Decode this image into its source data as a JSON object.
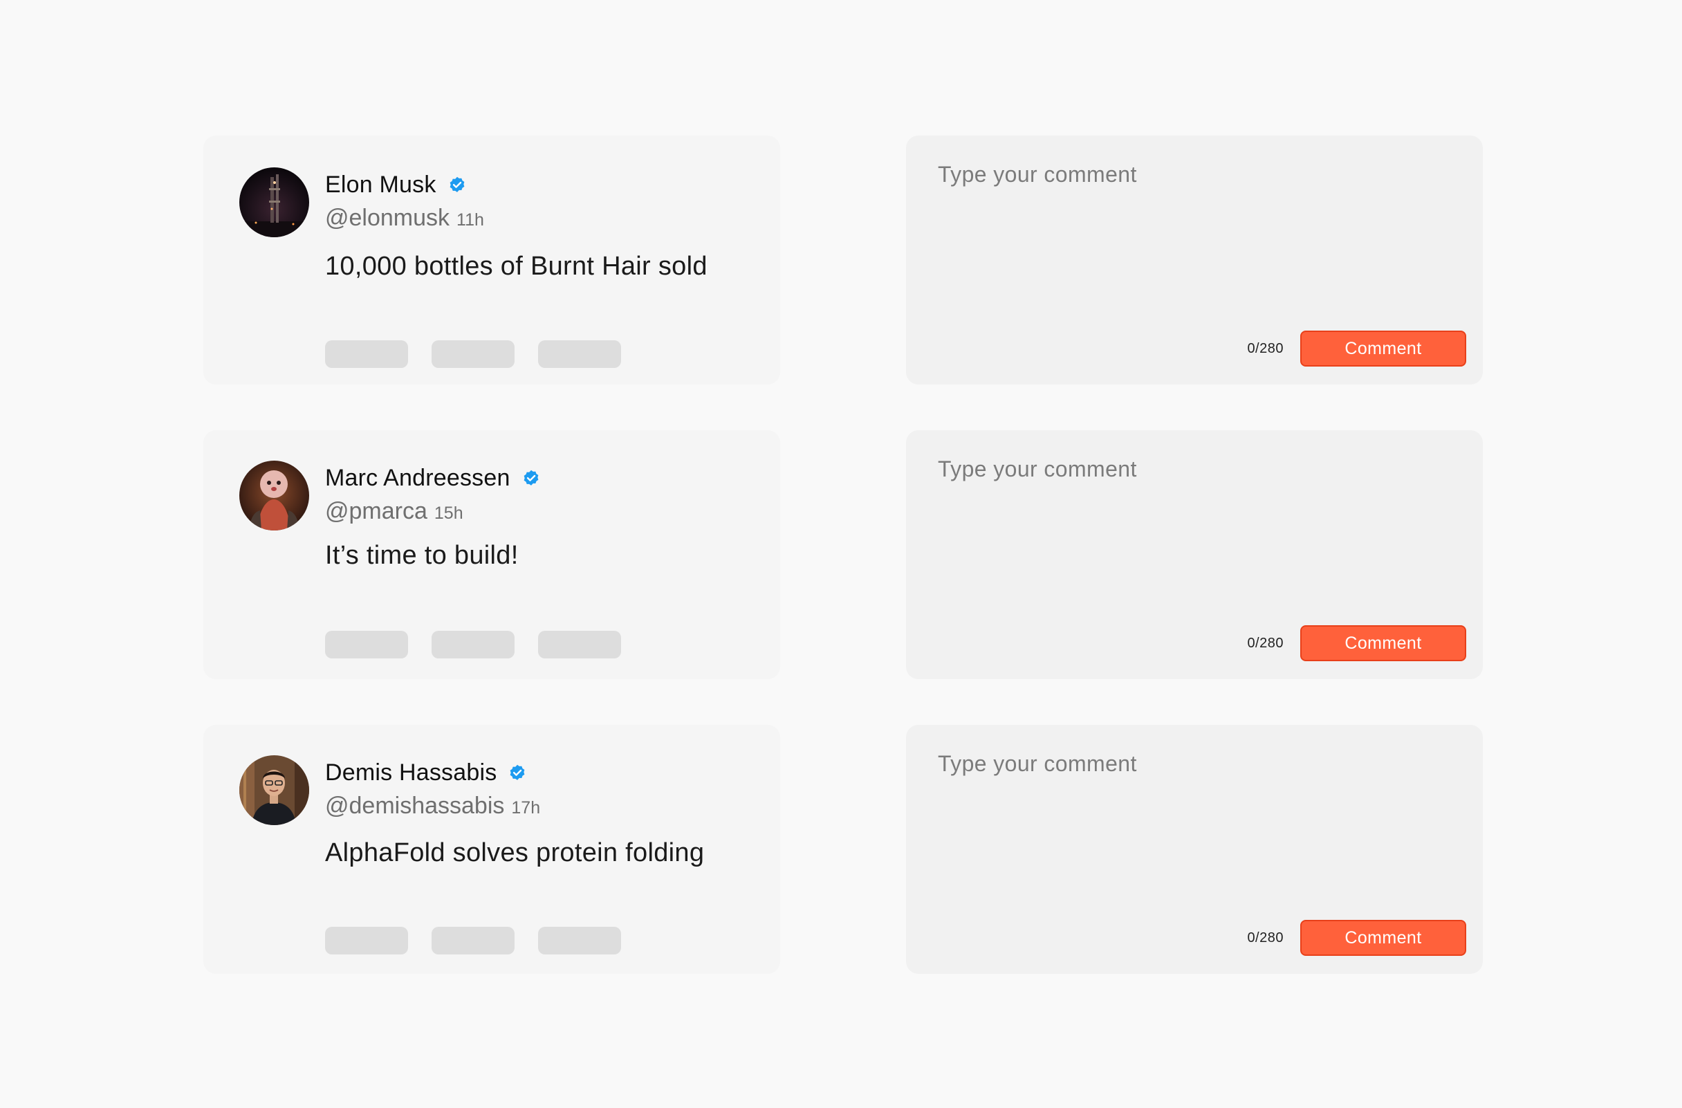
{
  "tweets": [
    {
      "name": "Elon Musk",
      "handle": "@elonmusk",
      "time": "11h",
      "text": "10,000 bottles of Burnt Hair sold"
    },
    {
      "name": "Marc Andreessen",
      "handle": "@pmarca",
      "time": "15h",
      "text": "It’s time to build!"
    },
    {
      "name": "Demis Hassabis",
      "handle": "@demishassabis",
      "time": "17h",
      "text": "AlphaFold solves protein folding"
    }
  ],
  "comment_boxes": [
    {
      "placeholder": "Type your comment",
      "value": "",
      "count": "0/280",
      "button_label": "Comment"
    },
    {
      "placeholder": "Type your comment",
      "value": "",
      "count": "0/280",
      "button_label": "Comment"
    },
    {
      "placeholder": "Type your comment",
      "value": "",
      "count": "0/280",
      "button_label": "Comment"
    }
  ],
  "colors": {
    "page_background": "#f9f9f9",
    "tweet_card": "#f5f5f5",
    "comment_card": "#f1f1f1",
    "action_placeholder": "#dddddd",
    "verified_badge": "#1d9bf0",
    "button": "#ff613b",
    "button_border": "#e8401a"
  },
  "icons": {
    "verified": "verified-badge-icon"
  }
}
